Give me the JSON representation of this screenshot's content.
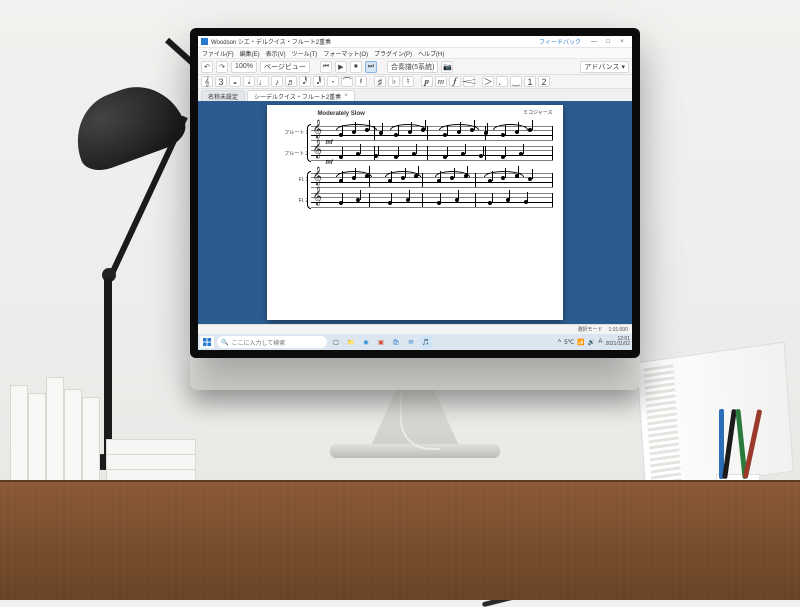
{
  "window": {
    "title": "Woodson シエ・デルクイス・フルート2重奏",
    "min": "—",
    "max": "□",
    "close": "×",
    "feedback": "フィードバック"
  },
  "menubar": [
    "ファイル(F)",
    "編集(E)",
    "表示(V)",
    "ツール(T)",
    "フォーマット(O)",
    "プラグイン(P)",
    "ヘルプ(H)"
  ],
  "toolbar": {
    "undo": "↶",
    "redo": "↷",
    "zoom": "100%",
    "page_label": "ページビュー",
    "rew": "⏮",
    "play": "▶",
    "stop": "⏹",
    "ff": "⏭",
    "score_label": "合奏譜(5系統)",
    "camera": "📷",
    "advance": "アドバンス ▾"
  },
  "notebar": {
    "selector": "𝄞",
    "triplet": "3",
    "durations": [
      "𝅝",
      "𝅗𝅥",
      "♩",
      "♪",
      "♬",
      "𝅘𝅥𝅰",
      "𝅘𝅥𝅱"
    ],
    "dot": "･",
    "tie": "⌒",
    "rest": "𝄽",
    "sharp": "♯",
    "flat": "♭",
    "natural": "♮",
    "dyn": [
      "𝆏",
      "𝆐",
      "𝆑",
      "𝆒"
    ],
    "marks": [
      "＞",
      "．",
      "‿",
      "1",
      "2"
    ]
  },
  "tabs": [
    {
      "label": "名称未設定",
      "active": false
    },
    {
      "label": "シーデルクイス・フルート2重奏",
      "active": true,
      "close": "×"
    }
  ],
  "score": {
    "tempo": "Moderately Slow",
    "composer": "ミコジャース",
    "system1": {
      "parts": [
        "フルート 1",
        "フルート 2"
      ],
      "dynamic": "mf"
    },
    "system2": {
      "parts": [
        "Fl. 1",
        "Fl. 2"
      ]
    }
  },
  "statusbar": {
    "mode": "選択モード",
    "meas": "1:01:000"
  },
  "taskbar": {
    "search_placeholder": "ここに入力して検索",
    "weather": "5℃",
    "time": "12:01",
    "date": "2021/11/02"
  },
  "colors": {
    "workspace": "#2c5c8f",
    "accent": "#2b7bd1"
  }
}
